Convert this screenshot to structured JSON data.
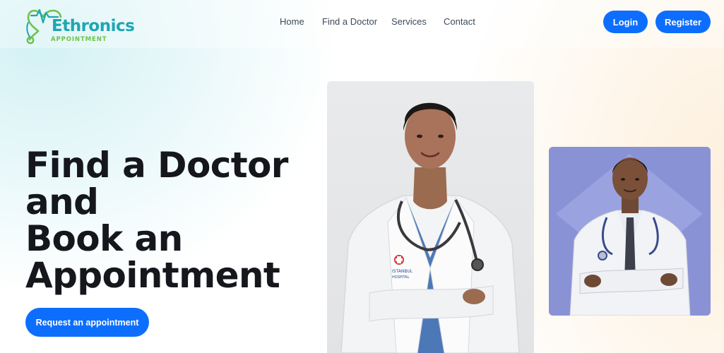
{
  "brand": {
    "name": "Ethronics",
    "tagline": "APPOINTMENT",
    "accent": "#1fa6b1",
    "tagline_color": "#6cc24a"
  },
  "nav": {
    "links": [
      "Home",
      "Find a Doctor",
      "Services",
      "Contact"
    ],
    "login_label": "Login",
    "register_label": "Register"
  },
  "hero": {
    "title_lines": [
      "Find a Doctor",
      "and",
      "Book an",
      "Appointment"
    ],
    "cta_label": "Request an appointment",
    "primary_color": "#0d6efd"
  },
  "photos": {
    "female_doctor_badge": [
      "ISTANBUL",
      "HOSPITAL"
    ],
    "card_bg_1": "#e6e7e9",
    "card_bg_2": "#8b94d8"
  }
}
